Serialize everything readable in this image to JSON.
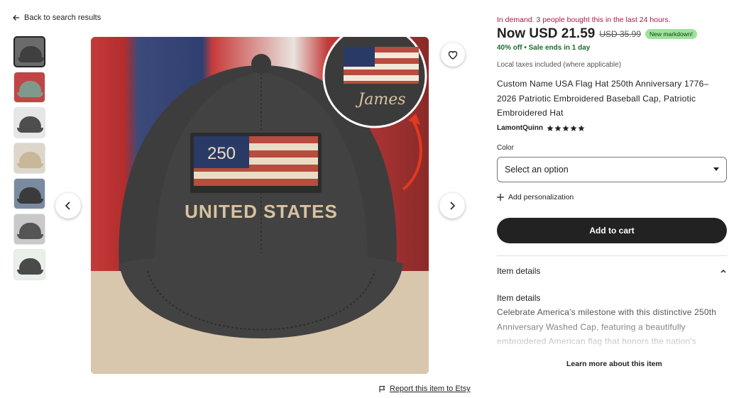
{
  "nav": {
    "back_label": "Back to search results"
  },
  "gallery": {
    "thumbnails": [
      {
        "label": "thumbnail 1",
        "cap_color": "#3f3f3f",
        "bg_color": "#6b6b6b",
        "active": true
      },
      {
        "label": "thumbnail 2",
        "cap_color": "#7f9a8a",
        "bg_color": "#c24545",
        "active": false
      },
      {
        "label": "thumbnail 3",
        "cap_color": "#4e4e4e",
        "bg_color": "#e6e6e6",
        "active": false
      },
      {
        "label": "thumbnail 4",
        "cap_color": "#c9b79a",
        "bg_color": "#ddd6cb",
        "active": false
      },
      {
        "label": "thumbnail 5",
        "cap_color": "#3b3b3b",
        "bg_color": "#7a8aa0",
        "active": false
      },
      {
        "label": "thumbnail 6",
        "cap_color": "#555555",
        "bg_color": "#c9c9c9",
        "active": false
      },
      {
        "label": "thumbnail 7",
        "cap_color": "#4a4a4a",
        "bg_color": "#e9efe9",
        "active": false
      }
    ],
    "hat_number": "250",
    "hat_text": "UNITED STATES",
    "personalized_name": "James",
    "prev_icon": "chevron-left-icon",
    "next_icon": "chevron-right-icon",
    "favorite_icon": "heart-icon"
  },
  "report_label": "Report this item to Etsy",
  "listing": {
    "demand_text": "In demand. 3 people bought this in the last 24 hours.",
    "price_now": "Now USD 21.59",
    "price_original": "USD 35.99",
    "markdown_badge": "New markdown!",
    "discount_text": "40% off",
    "sale_text": "Sale ends in 1 day",
    "taxes_text": "Local taxes included (where applicable)",
    "title": "Custom Name USA Flag Hat 250th Anniversary 1776–2026 Patriotic Embroidered Baseball Cap, Patriotic Embroidered Hat",
    "shop_name": "LamontQuinn",
    "rating": 5,
    "color_label": "Color",
    "select_placeholder": "Select an option",
    "add_personalization": "Add personalization",
    "add_to_cart": "Add to cart",
    "details_heading": "Item details",
    "details_subheading": "Item details",
    "description": "Celebrate America's milestone with this distinctive 250th Anniversary Washed Cap, featuring a beautifully embroidered American flag that honors the nation's",
    "learn_more": "Learn more about this item"
  },
  "colors": {
    "demand": "#a61a4a",
    "discount": "#1d6b2a",
    "badge_bg": "#9ee29a",
    "cart_bg": "#222222"
  }
}
